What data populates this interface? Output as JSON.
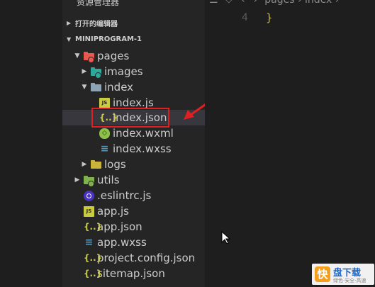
{
  "sidebar": {
    "title": "资源管理器",
    "more_glyph": "···",
    "open_editors_label": "打开的编辑器",
    "project_label": "MINIPROGRAM-1"
  },
  "tree": [
    {
      "label": "pages",
      "expanded": true,
      "icon": "folder-pages-icon",
      "icon_color": "#e8584e"
    },
    {
      "label": "images",
      "expanded": false,
      "icon": "folder-images-icon",
      "icon_color": "#2fa89c"
    },
    {
      "label": "index",
      "expanded": true,
      "icon": "folder-open-icon",
      "icon_color": "#8ea4b5"
    },
    {
      "label": "index.js",
      "icon": "js-file-icon",
      "icon_text": "JS"
    },
    {
      "label": "index.json",
      "icon": "json-file-icon",
      "icon_text": "{..}",
      "selected": true
    },
    {
      "label": "index.wxml",
      "icon": "wxml-file-icon",
      "icon_text": "◇"
    },
    {
      "label": "index.wxss",
      "icon": "wxss-file-icon",
      "icon_text": "≡"
    },
    {
      "label": "logs",
      "expanded": false,
      "icon": "folder-icon",
      "icon_color": "#c9b53a"
    },
    {
      "label": "utils",
      "expanded": false,
      "icon": "folder-utils-icon",
      "icon_color": "#7fb24a"
    },
    {
      "label": ".eslintrc.js",
      "icon": "eslint-file-icon"
    },
    {
      "label": "app.js",
      "icon": "js-file-icon",
      "icon_text": "JS"
    },
    {
      "label": "app.json",
      "icon": "json-file-icon",
      "icon_text": "{..}"
    },
    {
      "label": "app.wxss",
      "icon": "wxss-file-icon",
      "icon_text": "≡"
    },
    {
      "label": "project.config.json",
      "icon": "json-file-icon",
      "icon_text": "{..}"
    },
    {
      "label": "sitemap.json",
      "icon": "json-file-icon",
      "icon_text": "{..}"
    }
  ],
  "editor": {
    "breadcrumb": "pages › index ›",
    "line_number": "4",
    "code": "}"
  },
  "colors": {
    "accent_red": "#e02020",
    "json_yellow": "#cbcb41",
    "wxss_blue": "#519aba"
  },
  "watermark": {
    "logo_char": "快",
    "name": "盘下载",
    "tagline": "绿色·安全·高速"
  }
}
